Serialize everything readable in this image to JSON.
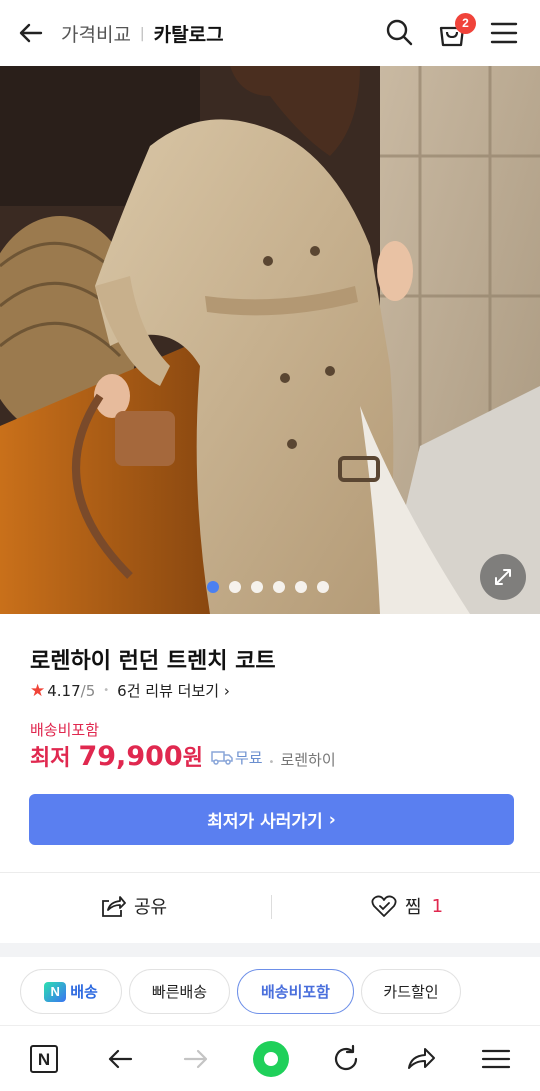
{
  "header": {
    "subtitle": "가격비교",
    "separator": "|",
    "title": "카탈로그",
    "cart_count": "2"
  },
  "gallery": {
    "total_images": 6,
    "active_index": 0
  },
  "product": {
    "title": "로렌하이 런던 트렌치 코트",
    "rating_value": "4.17",
    "rating_max": "/5",
    "review_link": "6건 리뷰 더보기",
    "shipping_label": "배송비포함",
    "price_prefix": "최저",
    "price": "79,900",
    "price_unit": "원",
    "free_shipping": "무료",
    "seller": "로렌하이"
  },
  "buy_button": {
    "label": "최저가 사러가기"
  },
  "actions": {
    "share_label": "공유",
    "like_label": "찜",
    "like_count": "1"
  },
  "filters": {
    "n_logo": "N",
    "n_delivery": "배송",
    "fast_delivery": "빠른배송",
    "shipping_included": "배송비포함",
    "card_discount": "카드할인"
  },
  "bottom_nav": {
    "n_logo": "N"
  },
  "colors": {
    "accent_blue": "#5a7ff0",
    "price_red": "#e0284f",
    "badge_red": "#f0433a"
  }
}
